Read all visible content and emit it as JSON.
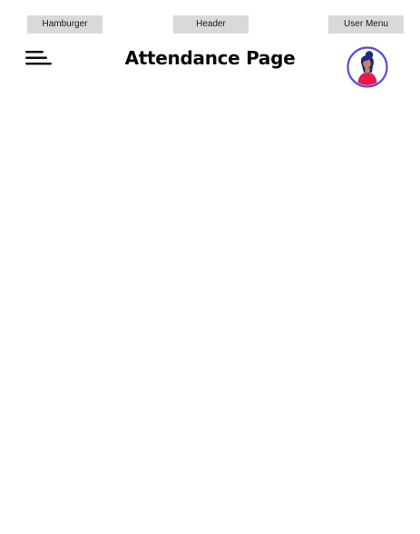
{
  "annotations": {
    "hamburger": "Hamburger",
    "header": "Header",
    "user_menu": "User Menu"
  },
  "header": {
    "title": "Attendance Page"
  },
  "icons": {
    "menu": "hamburger-menu-icon",
    "avatar": "user-avatar-icon"
  },
  "colors": {
    "annotation_bg": "#d9d9d9",
    "avatar_ring": "#5b4ce6",
    "avatar_hair": "#1f2a7a",
    "avatar_shirt": "#e6194b",
    "avatar_skin": "#c98363"
  }
}
